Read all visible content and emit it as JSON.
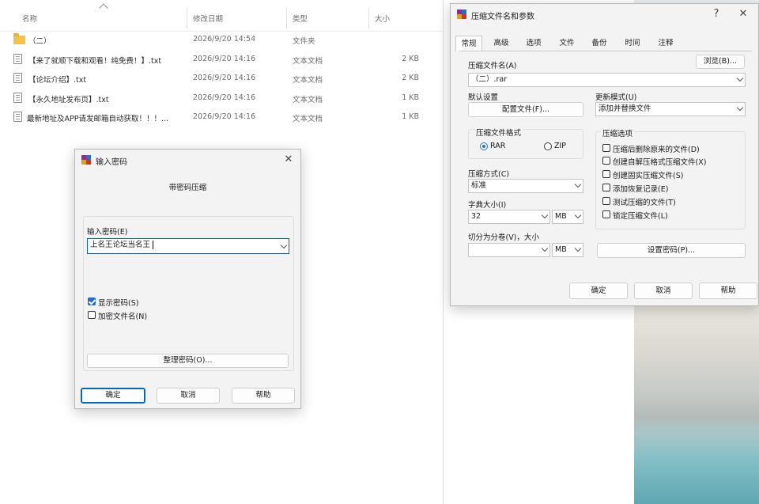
{
  "explorer": {
    "columns": {
      "name": "名称",
      "date": "修改日期",
      "type": "类型",
      "size": "大小"
    },
    "files": [
      {
        "name": "（二）",
        "date": "2026/9/20 14:54",
        "type": "文件夹",
        "size": "",
        "icon": "folder-icon"
      },
      {
        "name": "【来了就顺下载和观看！纯免费！】.txt",
        "date": "2026/9/20 14:16",
        "type": "文本文档",
        "size": "2 KB",
        "icon": "text-file-icon"
      },
      {
        "name": "【论坛介绍】.txt",
        "date": "2026/9/20 14:16",
        "type": "文本文档",
        "size": "2 KB",
        "icon": "text-file-icon"
      },
      {
        "name": "【永久地址发布页】.txt",
        "date": "2026/9/20 14:16",
        "type": "文本文档",
        "size": "1 KB",
        "icon": "text-file-icon"
      },
      {
        "name": "最新地址及APP请发邮箱自动获取！！！...",
        "date": "2026/9/20 14:16",
        "type": "文本文档",
        "size": "1 KB",
        "icon": "text-file-icon"
      }
    ]
  },
  "password_dialog": {
    "title": "输入密码",
    "heading": "带密码压缩",
    "password_label": "输入密码(E)",
    "password_value": "上名王论坛当名王",
    "show_password_label": "显示密码(S)",
    "show_password_checked": true,
    "encrypt_names_label": "加密文件名(N)",
    "encrypt_names_checked": false,
    "organize_button": "整理密码(O)...",
    "ok_button": "确定",
    "cancel_button": "取消",
    "help_button": "帮助"
  },
  "archive_dialog": {
    "title": "压缩文件名和参数",
    "help_glyph": "?",
    "close_glyph": "✕",
    "tabs": [
      "常规",
      "高级",
      "选项",
      "文件",
      "备份",
      "时间",
      "注释"
    ],
    "active_tab": "常规",
    "archive_name_label": "压缩文件名(A)",
    "browse_button": "浏览(B)...",
    "archive_name_value": "（二）.rar",
    "default_settings_label": "默认设置",
    "profiles_button": "配置文件(F)...",
    "update_mode_label": "更新模式(U)",
    "update_mode_value": "添加并替换文件",
    "format_group_label": "压缩文件格式",
    "format_rar": "RAR",
    "format_zip": "ZIP",
    "format_selected": "RAR",
    "method_label": "压缩方式(C)",
    "method_value": "标准",
    "dict_label": "字典大小(I)",
    "dict_value": "32",
    "dict_unit": "MB",
    "split_label": "切分为分卷(V)，大小",
    "split_value": "",
    "split_unit": "MB",
    "options_group_label": "压缩选项",
    "options": [
      {
        "label": "压缩后删除原来的文件(D)",
        "checked": false
      },
      {
        "label": "创建自解压格式压缩文件(X)",
        "checked": false
      },
      {
        "label": "创建固实压缩文件(S)",
        "checked": false
      },
      {
        "label": "添加恢复记录(E)",
        "checked": false
      },
      {
        "label": "测试压缩的文件(T)",
        "checked": false
      },
      {
        "label": "锁定压缩文件(L)",
        "checked": false
      }
    ],
    "set_password_button": "设置密码(P)...",
    "ok_button": "确定",
    "cancel_button": "取消",
    "help_button": "帮助"
  },
  "colors": {
    "accent": "#0067c0",
    "checkbox_on": "#1f6fd1",
    "folder": "#f2c24b"
  }
}
